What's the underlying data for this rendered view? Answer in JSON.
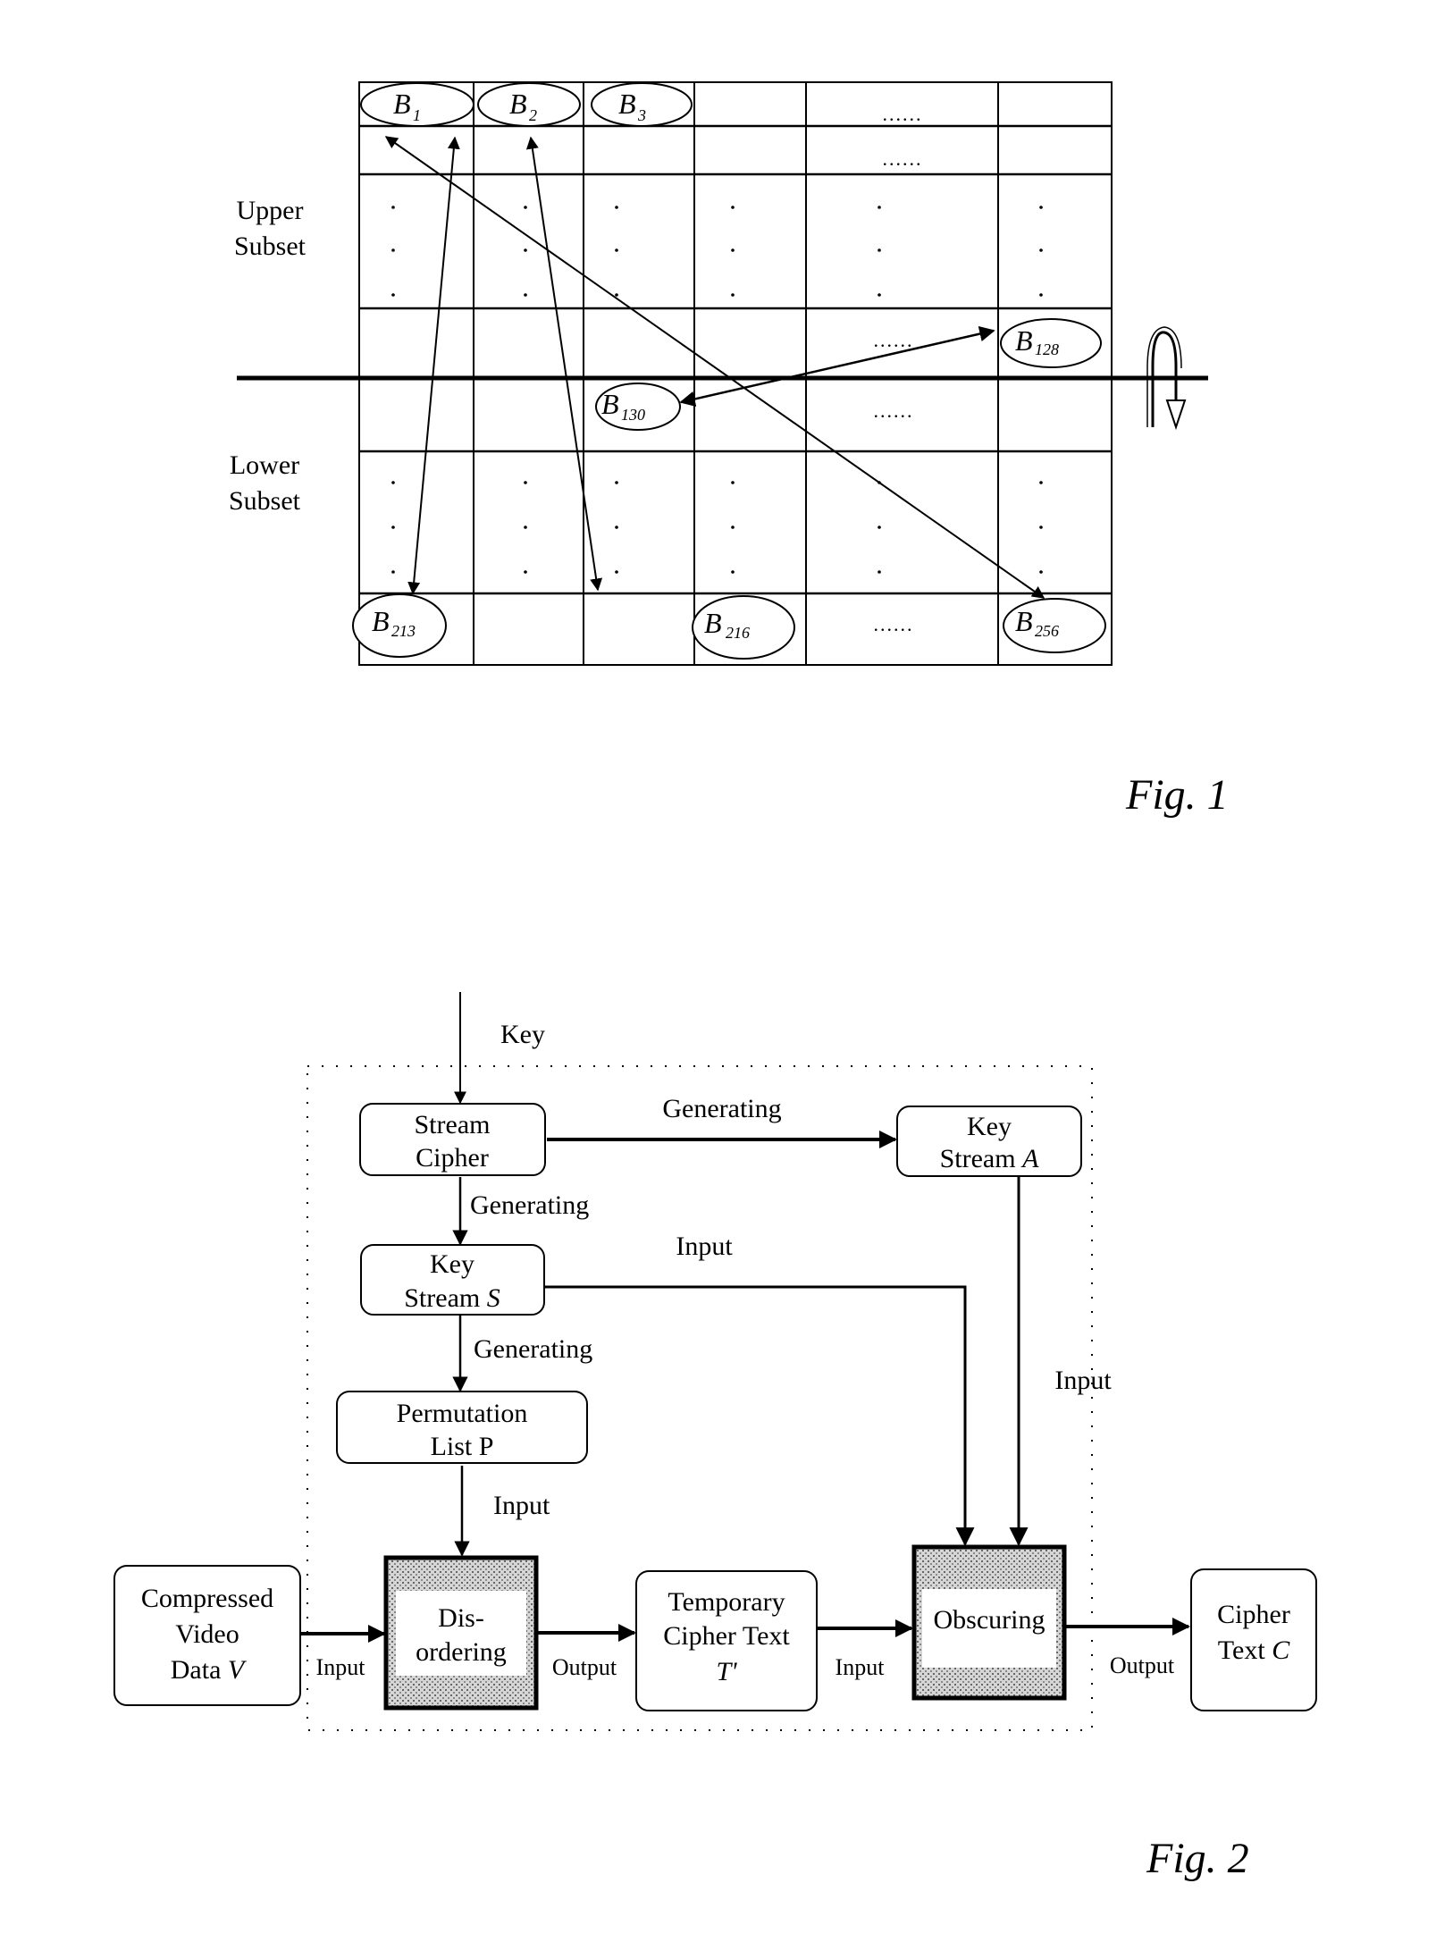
{
  "fig1": {
    "caption": "Fig. 1",
    "upper_label_line1": "Upper",
    "upper_label_line2": "Subset",
    "lower_label_line1": "Lower",
    "lower_label_line2": "Subset",
    "ellipsis": "......",
    "vertical_dot": "·",
    "blocks": {
      "b1": {
        "base": "B",
        "sub": "1"
      },
      "b2": {
        "base": "B",
        "sub": "2"
      },
      "b3": {
        "base": "B",
        "sub": "3"
      },
      "b128": {
        "base": "B",
        "sub": "128"
      },
      "b130": {
        "base": "B",
        "sub": "130"
      },
      "b213": {
        "base": "B",
        "sub": "213"
      },
      "b216": {
        "base": "B",
        "sub": "216"
      },
      "b256": {
        "base": "B",
        "sub": "256"
      }
    },
    "swaps": [
      {
        "from": "B1",
        "to": "B256"
      },
      {
        "from": "B2",
        "to": "B213"
      },
      {
        "from": "B3",
        "to": "B216"
      },
      {
        "from": "B128",
        "to": "B130"
      }
    ],
    "flip_icon": "rotate-flip-icon"
  },
  "fig2": {
    "caption": "Fig. 2",
    "key_label": "Key",
    "nodes": {
      "stream_cipher": {
        "line1": "Stream",
        "line2": "Cipher"
      },
      "key_stream_a": {
        "line1": "Key",
        "line2": "Stream ",
        "var": "A"
      },
      "key_stream_s": {
        "line1": "Key",
        "line2": "Stream ",
        "var": "S"
      },
      "permutation": {
        "line1": "Permutation",
        "line2": "List P"
      },
      "video": {
        "line1": "Compressed",
        "line2": "Video",
        "line3": "Data ",
        "var": "V"
      },
      "disordering": {
        "line1": "Dis-",
        "line2": "ordering"
      },
      "temp_cipher": {
        "line1": "Temporary",
        "line2": "Cipher Text",
        "var": "T'"
      },
      "obscuring": {
        "line1": "Obscuring"
      },
      "cipher_text": {
        "line1": "Cipher",
        "line2": "Text ",
        "var": "C"
      }
    },
    "edge_labels": {
      "sc_to_ksa": "Generating",
      "sc_to_kss": "Generating",
      "kss_to_obs": "Input",
      "kss_to_perm": "Generating",
      "ksa_to_obs": "Input",
      "perm_to_dis": "Input",
      "video_to_dis": "Input",
      "dis_to_temp": "Output",
      "temp_to_obs": "Input",
      "obs_to_cipher": "Output"
    }
  }
}
